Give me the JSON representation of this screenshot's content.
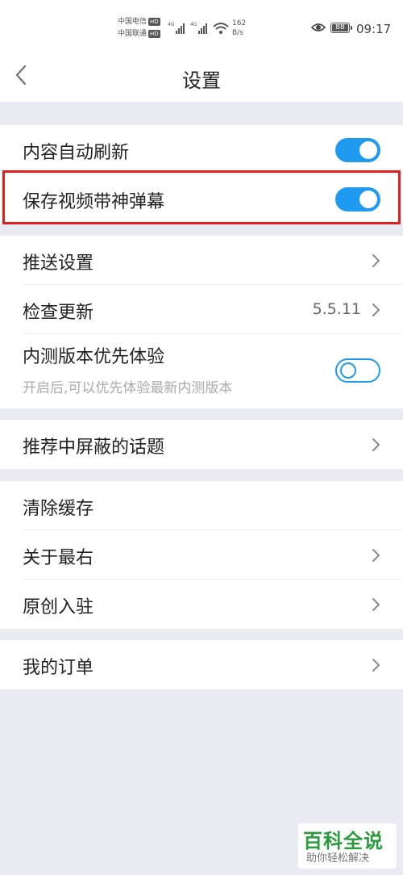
{
  "status_bar": {
    "carrier_1": "中国电信",
    "carrier_2": "中国联通",
    "hd_badge": "HD",
    "network_1": "4G",
    "network_2": "4G",
    "net_speed_value": "162",
    "net_speed_unit": "B/s",
    "battery": "88",
    "time": "09:17"
  },
  "header": {
    "title": "设置"
  },
  "settings": {
    "auto_refresh": {
      "label": "内容自动刷新",
      "enabled": true
    },
    "save_video_danmaku": {
      "label": "保存视频带神弹幕",
      "enabled": true
    },
    "push_settings": {
      "label": "推送设置"
    },
    "check_update": {
      "label": "检查更新",
      "value": "5.5.11"
    },
    "beta_priority": {
      "label": "内测版本优先体验",
      "description": "开启后,可以优先体验最新内测版本",
      "enabled": false
    },
    "blocked_topics": {
      "label": "推荐中屏蔽的话题"
    },
    "clear_cache": {
      "label": "清除缓存"
    },
    "about": {
      "label": "关于最右"
    },
    "creator_join": {
      "label": "原创入驻"
    },
    "my_orders": {
      "label": "我的订单"
    }
  },
  "colors": {
    "accent": "#1e9af0",
    "highlight_box": "#e02020",
    "page_background": "#ebebf4"
  },
  "watermark": {
    "title": "百科全说",
    "subtitle": "助你轻松解决"
  }
}
